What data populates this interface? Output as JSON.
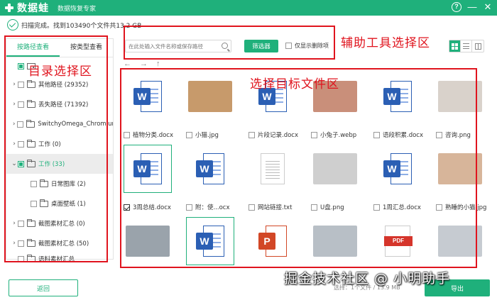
{
  "app": {
    "name": "数据蛙",
    "subtitle": "数据恢复专家"
  },
  "status": {
    "text": "扫描完成。找到103490个文件共13.2 GB"
  },
  "left_panel": {
    "tabs": [
      {
        "label": "按路径查看",
        "active": true
      },
      {
        "label": "按类型查看",
        "active": false
      }
    ],
    "tree": [
      {
        "label": "",
        "arrow": "",
        "level": 0,
        "checkbox": "partial",
        "icon": "drive"
      },
      {
        "label": "其他路径 (29352)",
        "arrow": "›",
        "level": 0,
        "checkbox": "empty",
        "icon": "folder"
      },
      {
        "label": "丢失路径 (71392)",
        "arrow": "›",
        "level": 0,
        "checkbox": "empty",
        "icon": "folder"
      },
      {
        "label": "SwitchyOmega_Chromium",
        "arrow": "›",
        "level": 0,
        "checkbox": "empty",
        "icon": "folder"
      },
      {
        "label": "工作 (0)",
        "arrow": "›",
        "level": 0,
        "checkbox": "empty",
        "icon": "folder"
      },
      {
        "label": "工作 (33)",
        "arrow": "⌄",
        "level": 0,
        "checkbox": "partial",
        "icon": "folder",
        "selected": true
      },
      {
        "label": "日常图库 (2)",
        "arrow": "",
        "level": 1,
        "checkbox": "empty",
        "icon": "folder"
      },
      {
        "label": "桌面壁纸 (1)",
        "arrow": "",
        "level": 1,
        "checkbox": "empty",
        "icon": "folder"
      },
      {
        "label": "截图素材汇总 (0)",
        "arrow": "›",
        "level": 0,
        "checkbox": "empty",
        "icon": "folder"
      },
      {
        "label": "截图素材汇总 (50)",
        "arrow": "›",
        "level": 0,
        "checkbox": "empty",
        "icon": "folder"
      },
      {
        "label": "语料素材汇总",
        "arrow": "",
        "level": 0,
        "checkbox": "empty",
        "icon": "folder"
      }
    ]
  },
  "toolbar": {
    "search_placeholder": "在此处输入文件名称或保存路径",
    "filter_label": "筛选器",
    "deleted_only_label": "仅显示删除项"
  },
  "nav": {
    "back": "←",
    "forward": "→",
    "up": "↑"
  },
  "files": [
    {
      "name": "植物分类.docx",
      "type": "word",
      "checked": false
    },
    {
      "name": "小猫.jpg",
      "type": "photo",
      "color": "#c79a6b",
      "checked": false
    },
    {
      "name": "片段记录.docx",
      "type": "word",
      "checked": false
    },
    {
      "name": "小兔子.webp",
      "type": "photo",
      "color": "#c98f7a",
      "checked": false
    },
    {
      "name": "语段积累.docx",
      "type": "word",
      "checked": false
    },
    {
      "name": "咨询.png",
      "type": "photo",
      "color": "#d9d2cb",
      "checked": false
    },
    {
      "name": "3周总结.docx",
      "type": "word",
      "checked": true,
      "focus": true
    },
    {
      "name": "附：使...ocx",
      "type": "word",
      "checked": false
    },
    {
      "name": "网站链接.txt",
      "type": "txt",
      "checked": false
    },
    {
      "name": "U盘.png",
      "type": "photo",
      "color": "#cfcfcf",
      "checked": false
    },
    {
      "name": "1周汇总.docx",
      "type": "word",
      "checked": false
    },
    {
      "name": "熟睡的小猫.jpg",
      "type": "photo",
      "color": "#d7b59a",
      "checked": false
    },
    {
      "name": "",
      "type": "photo",
      "color": "#9aa3ab",
      "checked": false
    },
    {
      "name": "",
      "type": "word",
      "checked": false,
      "focus": true
    },
    {
      "name": "",
      "type": "ppt",
      "checked": false
    },
    {
      "name": "",
      "type": "photo",
      "color": "#b8bfc6",
      "checked": false
    },
    {
      "name": "",
      "type": "pdf",
      "badge": "PDF",
      "checked": false
    },
    {
      "name": "",
      "type": "photo",
      "color": "#c6cbd1",
      "checked": false
    }
  ],
  "annotations": {
    "dir_area": "目录选择区",
    "tools_area": "辅助工具选择区",
    "files_area": "选择目标文件区"
  },
  "bottom": {
    "back_label": "返回",
    "export_label": "导出",
    "info_text": "选择：1个文件 / 13.9 MB",
    "watermark": "掘金技术社区 @ 小明助手"
  },
  "colors": {
    "brand": "#1fb07b",
    "annotation": "#e0141e"
  }
}
